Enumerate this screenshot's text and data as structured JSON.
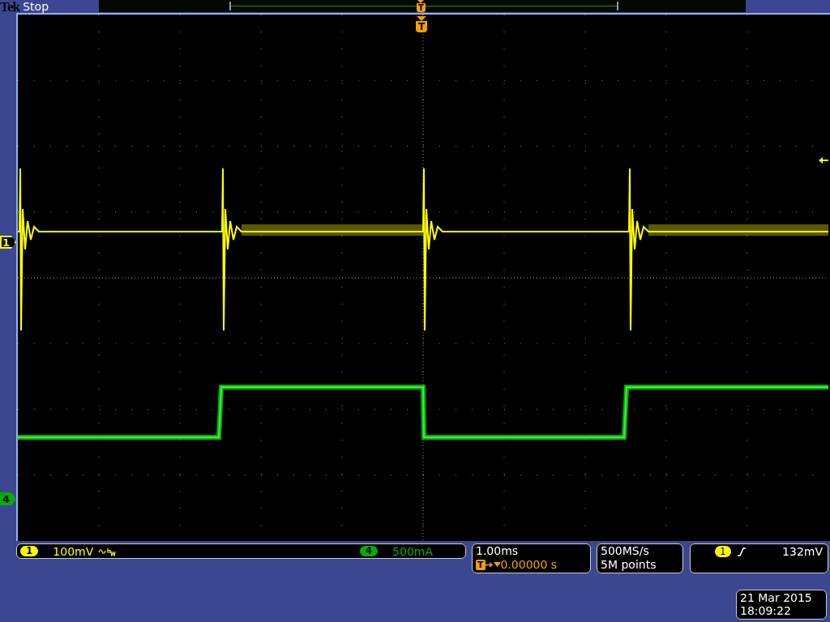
{
  "header": {
    "brand": "Tek",
    "run_state": "Stop"
  },
  "record_bar": {
    "trigger_label": "T"
  },
  "graticule": {
    "trigger_label": "T",
    "markers": [
      {
        "label": "1",
        "color": "#ffff00",
        "selected": true
      },
      {
        "label": "4",
        "color": "#00b000",
        "selected": false
      }
    ]
  },
  "channels": [
    {
      "label": "1",
      "scale": "100mV",
      "bandwidth_limited": true,
      "color": "#ffff00"
    },
    {
      "label": "4",
      "scale": "500mA",
      "bandwidth_limited": false,
      "color": "#00b000"
    }
  ],
  "timebase": {
    "scale": "1.00ms",
    "trigger_label": "T",
    "position": "0.00000 s"
  },
  "acquisition": {
    "sample_rate": "500MS/s",
    "record_length": "5M points"
  },
  "trigger": {
    "source": "1",
    "rising_edge": true,
    "level": "132mV",
    "color": "#ffff00"
  },
  "clock": {
    "date": "21 Mar 2015",
    "time": "18:09:22"
  }
}
